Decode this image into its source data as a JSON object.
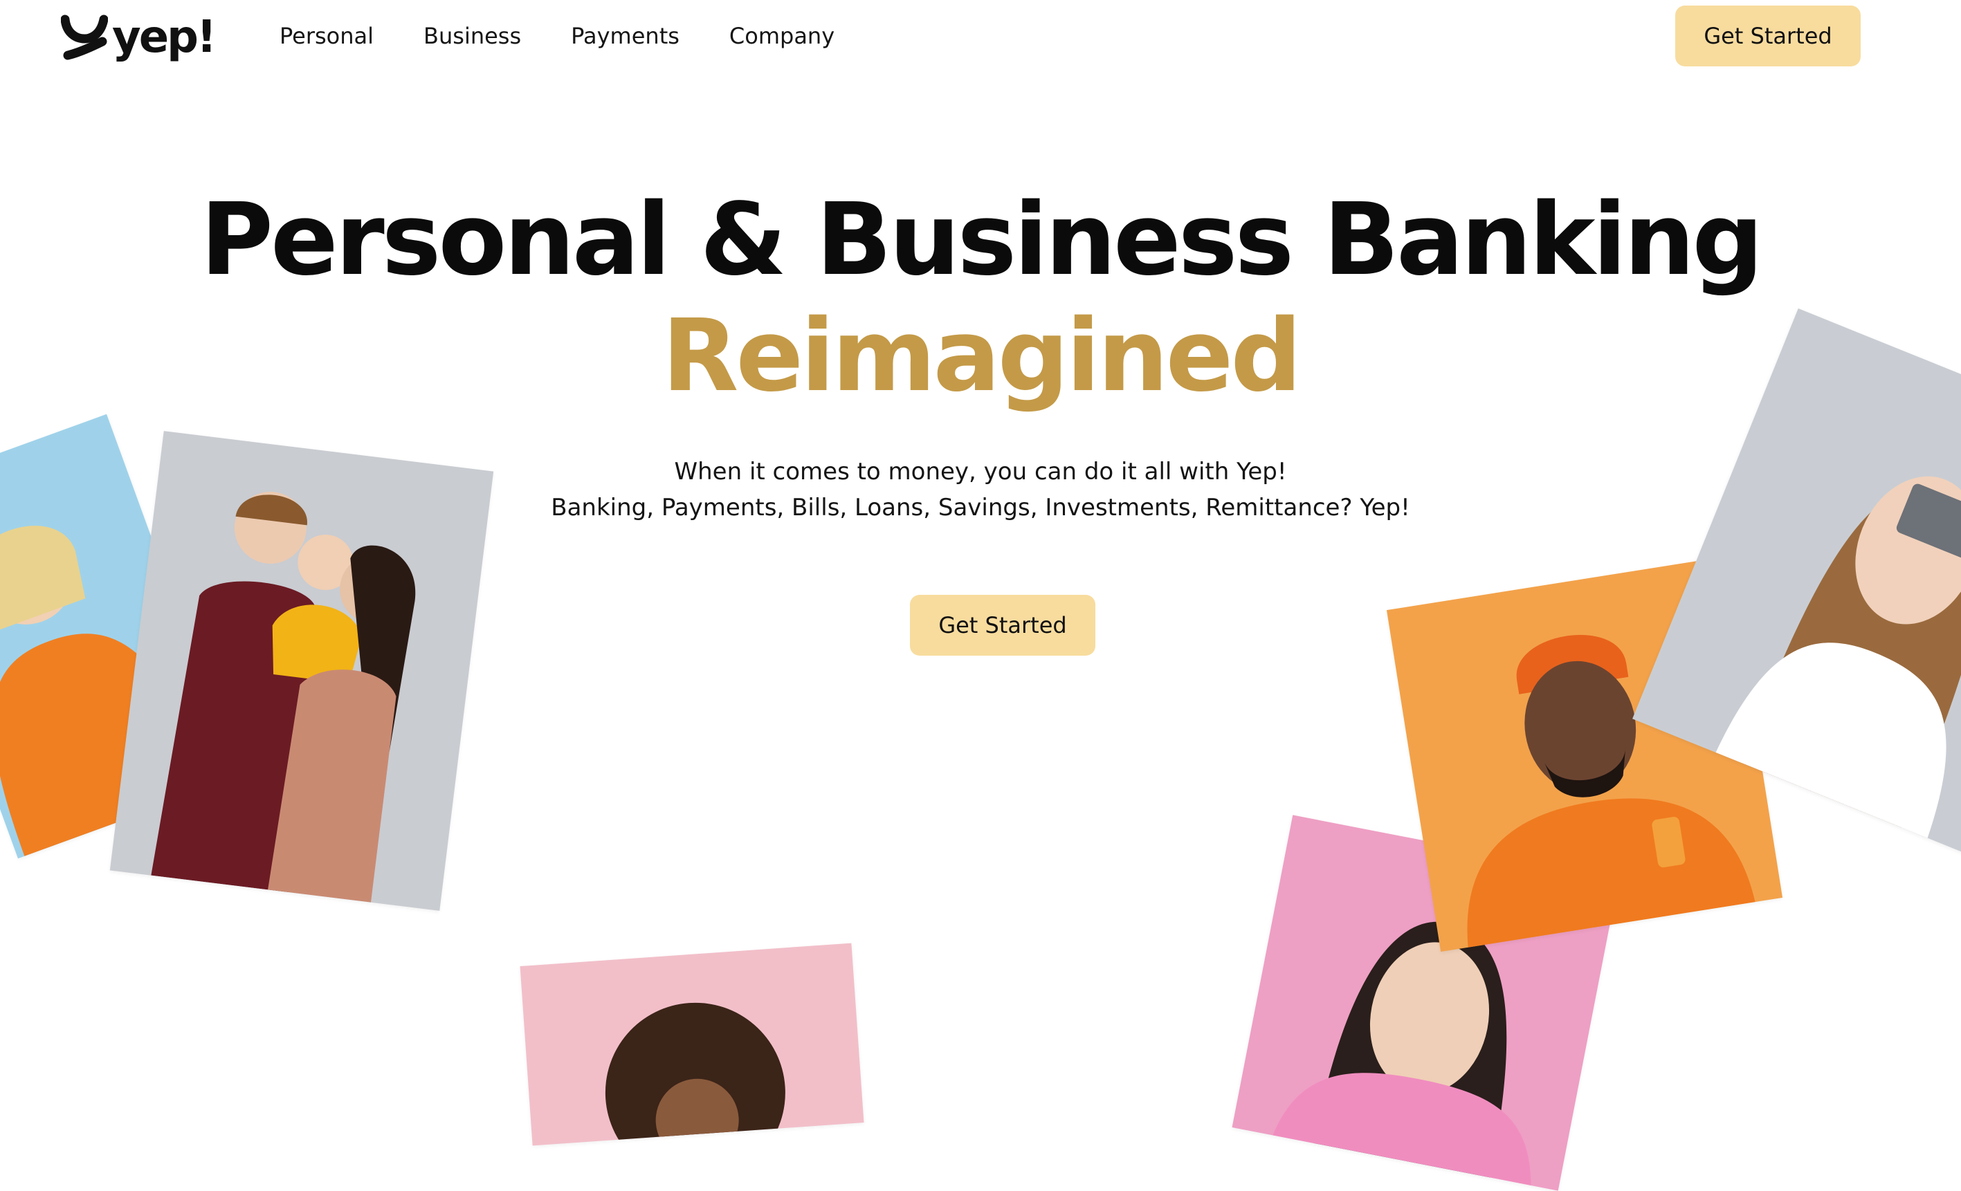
{
  "brand": {
    "name": "yep!",
    "accent_color": "#c49a48",
    "button_color": "#f8dc9e"
  },
  "nav": {
    "items": [
      "Personal",
      "Business",
      "Payments",
      "Company"
    ]
  },
  "header": {
    "cta_label": "Get Started"
  },
  "hero": {
    "title": "Personal & Business Banking",
    "title_accent": "Reimagined",
    "subtitle_line1": "When it comes to money, you can do it all with Yep!",
    "subtitle_line2": "Banking, Payments, Bills, Loans, Savings, Investments, Remittance? Yep!",
    "cta_label": "Get Started"
  }
}
